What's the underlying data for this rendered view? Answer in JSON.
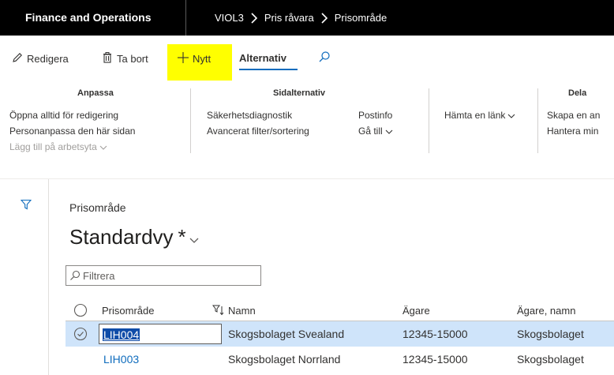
{
  "header": {
    "app_name": "Finance and Operations",
    "breadcrumb": [
      "VIOL3",
      "Pris råvara",
      "Prisområde"
    ]
  },
  "actions": {
    "edit": "Redigera",
    "delete": "Ta bort",
    "new": "Nytt",
    "options_tab": "Alternativ",
    "highlight_color": "#ffff00"
  },
  "ribbon": {
    "anpassa": {
      "title": "Anpassa",
      "items": [
        "Öppna alltid för redigering",
        "Personanpassa den här sidan",
        "Lägg till på arbetsyta"
      ]
    },
    "sidalternativ": {
      "title": "Sidalternativ",
      "items": [
        "Säkerhetsdiagnostik",
        "Avancerat filter/sortering",
        "Postinfo",
        "Gå till"
      ]
    },
    "dela": {
      "title": "Dela",
      "items": [
        "Hämta en länk",
        "Skapa en an",
        "Hantera min"
      ]
    }
  },
  "page": {
    "caption": "Prisområde",
    "view_title": "Standardvy",
    "modified_marker": "*",
    "filter_placeholder": "Filtrera"
  },
  "grid": {
    "columns": [
      "Prisområde",
      "Namn",
      "Ägare",
      "Ägare, namn"
    ],
    "rows": [
      {
        "prisomrade": "LIH004",
        "namn": "Skogsbolaget Svealand",
        "agare": "12345-15000",
        "agare_namn": "Skogsbolaget",
        "selected": true
      },
      {
        "prisomrade": "LIH003",
        "namn": "Skogsbolaget Norrland",
        "agare": "12345-15000",
        "agare_namn": "Skogsbolaget",
        "selected": false
      }
    ]
  },
  "colors": {
    "top_bar": "#000000",
    "accent": "#0f6cbd",
    "selected_row": "#cfe4fa"
  }
}
